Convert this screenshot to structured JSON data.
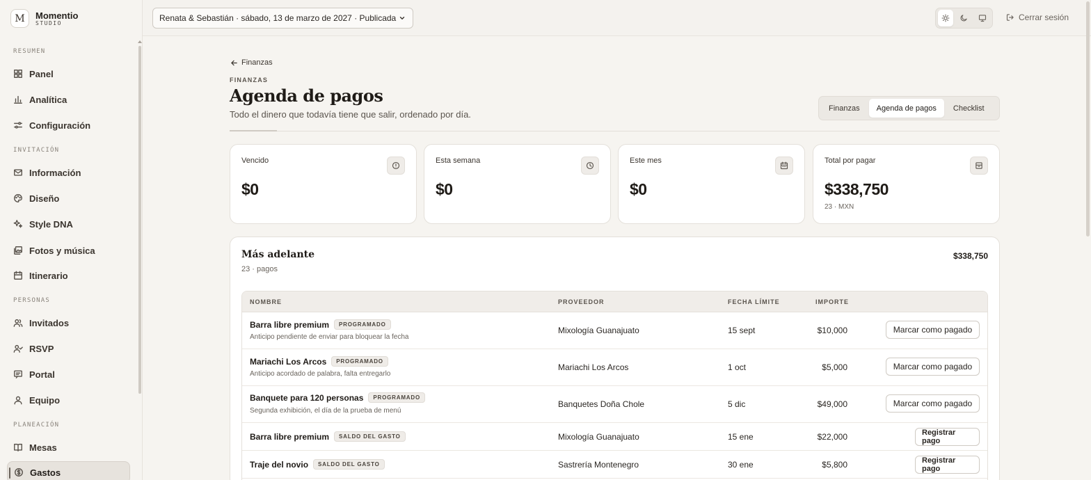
{
  "brand": {
    "name": "Momentio",
    "sub": "STUDIO",
    "logo": "M"
  },
  "sidebar": {
    "sections": [
      {
        "label": "RESUMEN",
        "items": [
          {
            "label": "Panel",
            "icon": "grid-icon"
          },
          {
            "label": "Analítica",
            "icon": "bar-chart-icon"
          },
          {
            "label": "Configuración",
            "icon": "sliders-icon"
          }
        ]
      },
      {
        "label": "INVITACIÓN",
        "items": [
          {
            "label": "Información",
            "icon": "mail-icon"
          },
          {
            "label": "Diseño",
            "icon": "palette-icon"
          },
          {
            "label": "Style DNA",
            "icon": "sparkles-icon"
          },
          {
            "label": "Fotos y música",
            "icon": "images-icon"
          },
          {
            "label": "Itinerario",
            "icon": "calendar-icon"
          }
        ]
      },
      {
        "label": "PERSONAS",
        "items": [
          {
            "label": "Invitados",
            "icon": "users-icon"
          },
          {
            "label": "RSVP",
            "icon": "user-check-icon"
          },
          {
            "label": "Portal",
            "icon": "message-icon"
          },
          {
            "label": "Equipo",
            "icon": "user-icon"
          }
        ]
      },
      {
        "label": "PLANEACIÓN",
        "items": [
          {
            "label": "Mesas",
            "icon": "book-icon"
          },
          {
            "label": "Gastos",
            "icon": "dollar-circle-icon",
            "active": true
          }
        ]
      }
    ]
  },
  "topbar": {
    "event_label": "Renata & Sebastián · sábado, 13 de marzo de 2027 · Publicada",
    "logout_label": "Cerrar sesión"
  },
  "page": {
    "back_label": "Finanzas",
    "eyebrow": "FINANZAS",
    "title": "Agenda de pagos",
    "subtitle": "Todo el dinero que todavía tiene que salir, ordenado por día.",
    "tabs": [
      "Finanzas",
      "Agenda de pagos",
      "Checklist"
    ],
    "active_tab": "Agenda de pagos"
  },
  "kpis": [
    {
      "label": "Vencido",
      "value": "$0",
      "note": "",
      "icon": "alert-circle-icon"
    },
    {
      "label": "Esta semana",
      "value": "$0",
      "note": "",
      "icon": "clock-icon"
    },
    {
      "label": "Este mes",
      "value": "$0",
      "note": "",
      "icon": "calendar-icon"
    },
    {
      "label": "Total por pagar",
      "value": "$338,750",
      "note": "23 · MXN",
      "icon": "archive-icon"
    }
  ],
  "upcoming": {
    "title": "Más adelante",
    "subtitle": "23 · pagos",
    "total": "$338,750",
    "columns": {
      "name": "NOMBRE",
      "vendor": "PROVEEDOR",
      "due": "FECHA LÍMITE",
      "amount": "IMPORTE"
    },
    "rows": [
      {
        "name": "Barra libre premium",
        "badge": "PROGRAMADO",
        "note": "Anticipo pendiente de enviar para bloquear la fecha",
        "vendor": "Mixología Guanajuato",
        "due": "15 sept",
        "amount": "$10,000",
        "action": "Marcar como pagado"
      },
      {
        "name": "Mariachi Los Arcos",
        "badge": "PROGRAMADO",
        "note": "Anticipo acordado de palabra, falta entregarlo",
        "vendor": "Mariachi Los Arcos",
        "due": "1 oct",
        "amount": "$5,000",
        "action": "Marcar como pagado"
      },
      {
        "name": "Banquete para 120 personas",
        "badge": "PROGRAMADO",
        "note": "Segunda exhibición, el día de la prueba de menú",
        "vendor": "Banquetes Doña Chole",
        "due": "5 dic",
        "amount": "$49,000",
        "action": "Marcar como pagado"
      },
      {
        "name": "Barra libre premium",
        "badge": "SALDO DEL GASTO",
        "note": "",
        "vendor": "Mixología Guanajuato",
        "due": "15 ene",
        "amount": "$22,000",
        "action": "Registrar pago"
      },
      {
        "name": "Traje del novio",
        "badge": "SALDO DEL GASTO",
        "note": "",
        "vendor": "Sastrería Montenegro",
        "due": "30 ene",
        "amount": "$5,800",
        "action": "Registrar pago"
      }
    ]
  }
}
